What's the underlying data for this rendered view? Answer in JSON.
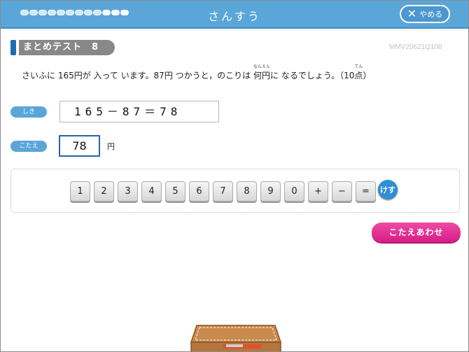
{
  "header": {
    "title": "さんすう",
    "quit_label": "やめる",
    "progress_total": 12,
    "progress_done": [
      9,
      10,
      11
    ]
  },
  "section": {
    "label": "まとめテスト　8",
    "code": "MMV20621Q108"
  },
  "question": {
    "text_before": "さいふに 165円が 入って います。87円 つかうと，のこりは ",
    "kanji_1": "何",
    "kanji_1_ruby": "なん",
    "kanji_2": "円",
    "kanji_2_ruby": "えん",
    "text_middle": "に なるでしょう。（10",
    "kanji_3": "点",
    "kanji_3_ruby": "てん",
    "text_after": "）"
  },
  "shiki": {
    "tag": "しき",
    "expression": "165－87＝78"
  },
  "kotae": {
    "tag": "こたえ",
    "value": "78",
    "unit": "円"
  },
  "keypad": {
    "keys": [
      "1",
      "2",
      "3",
      "4",
      "5",
      "6",
      "7",
      "8",
      "9",
      "0",
      "+",
      "−",
      "="
    ],
    "clear_label": "けす"
  },
  "check_label": "こたえあわせ",
  "colors": {
    "header": "#5aa6d9",
    "accent_pink": "#e3318f",
    "tag_blue": "#5aa6d9",
    "answer_border": "#2a64a8"
  }
}
